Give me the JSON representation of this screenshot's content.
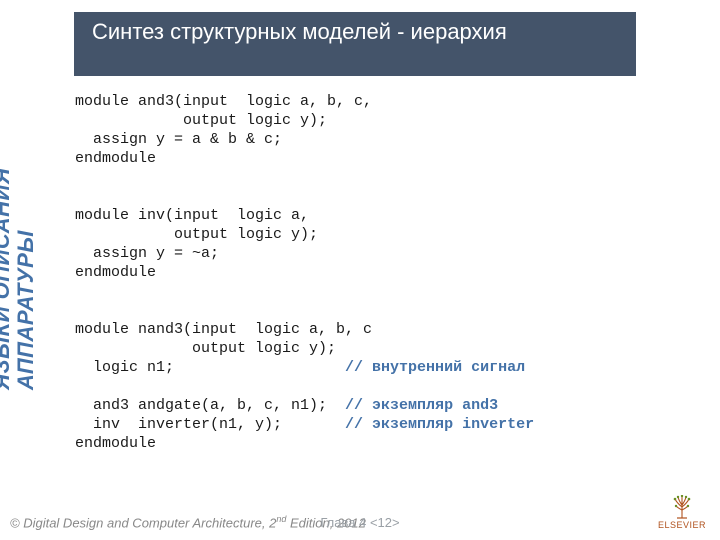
{
  "title": "Синтез структурных моделей - иерархия",
  "sidebar_line1": "ЯЗЫКИ ОПИСАНИЯ",
  "sidebar_line2": "АППАРАТУРЫ",
  "code": {
    "l1": "module and3(input  logic a, b, c,",
    "l2": "            output logic y);",
    "l3": "  assign y = a & b & c;",
    "l4": "endmodule",
    "l5": "",
    "l6": "",
    "l7": "module inv(input  logic a,",
    "l8": "           output logic y);",
    "l9": "  assign y = ~a;",
    "l10": "endmodule",
    "l11": "",
    "l12": "",
    "l13": "module nand3(input  logic a, b, c",
    "l14": "             output logic y);",
    "l15": "  logic n1;                   ",
    "c15": "// внутренний сигнал",
    "l16": "",
    "l17": "  and3 andgate(a, b, c, n1);  ",
    "c17": "// экземпляр and3",
    "l18": "  inv  inverter(n1, y);       ",
    "c18": "// экземпляр inverter",
    "l19": "endmodule"
  },
  "footer": {
    "copyright_pre": "© Digital Design and Computer Architecture, ",
    "edition": "2",
    "edition_suffix": "nd",
    "copyright_post": " Edition, 2012",
    "chapter": "Глава 4 ",
    "page": "<12>"
  },
  "logo": {
    "name": "ELSEVIER"
  }
}
